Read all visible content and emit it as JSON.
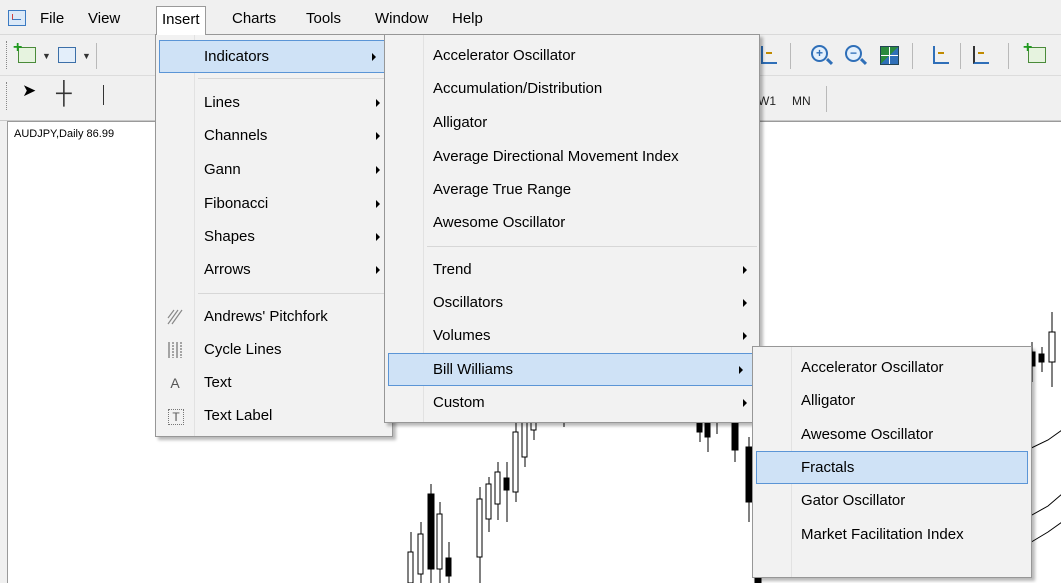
{
  "menubar": {
    "items": [
      "File",
      "View",
      "Insert",
      "Charts",
      "Tools",
      "Window",
      "Help"
    ],
    "active": "Insert"
  },
  "toolbar2": {
    "timeframes": [
      "W1",
      "MN"
    ]
  },
  "chart": {
    "title": "AUDJPY,Daily  86.99"
  },
  "insert_menu": {
    "items": [
      {
        "label": "Indicators",
        "submenu": true,
        "highlighted": true
      },
      {
        "label": "Lines",
        "submenu": true
      },
      {
        "label": "Channels",
        "submenu": true
      },
      {
        "label": "Gann",
        "submenu": true
      },
      {
        "label": "Fibonacci",
        "submenu": true
      },
      {
        "label": "Shapes",
        "submenu": true
      },
      {
        "label": "Arrows",
        "submenu": true
      },
      {
        "label": "Andrews' Pitchfork",
        "icon": "pitchfork-icon"
      },
      {
        "label": "Cycle Lines",
        "icon": "cycle-lines-icon"
      },
      {
        "label": "Text",
        "icon": "text-icon"
      },
      {
        "label": "Text Label",
        "icon": "text-label-icon"
      }
    ],
    "icon_glyphs": {
      "text": "A",
      "text_label": "T"
    }
  },
  "indicators_menu": {
    "items": [
      {
        "label": "Accelerator Oscillator"
      },
      {
        "label": "Accumulation/Distribution"
      },
      {
        "label": "Alligator"
      },
      {
        "label": "Average Directional Movement Index"
      },
      {
        "label": "Average True Range"
      },
      {
        "label": "Awesome Oscillator"
      },
      {
        "label": "Trend",
        "submenu": true
      },
      {
        "label": "Oscillators",
        "submenu": true
      },
      {
        "label": "Volumes",
        "submenu": true
      },
      {
        "label": "Bill Williams",
        "submenu": true,
        "highlighted": true
      },
      {
        "label": "Custom",
        "submenu": true
      }
    ]
  },
  "bill_williams_menu": {
    "items": [
      {
        "label": "Accelerator Oscillator"
      },
      {
        "label": "Alligator"
      },
      {
        "label": "Awesome Oscillator"
      },
      {
        "label": "Fractals",
        "highlighted": true
      },
      {
        "label": "Gator Oscillator"
      },
      {
        "label": "Market Facilitation Index"
      }
    ]
  },
  "colors": {
    "highlight_bg": "#cfe2f6",
    "highlight_border": "#5b95d6",
    "menu_bg": "#f2f2f2"
  }
}
